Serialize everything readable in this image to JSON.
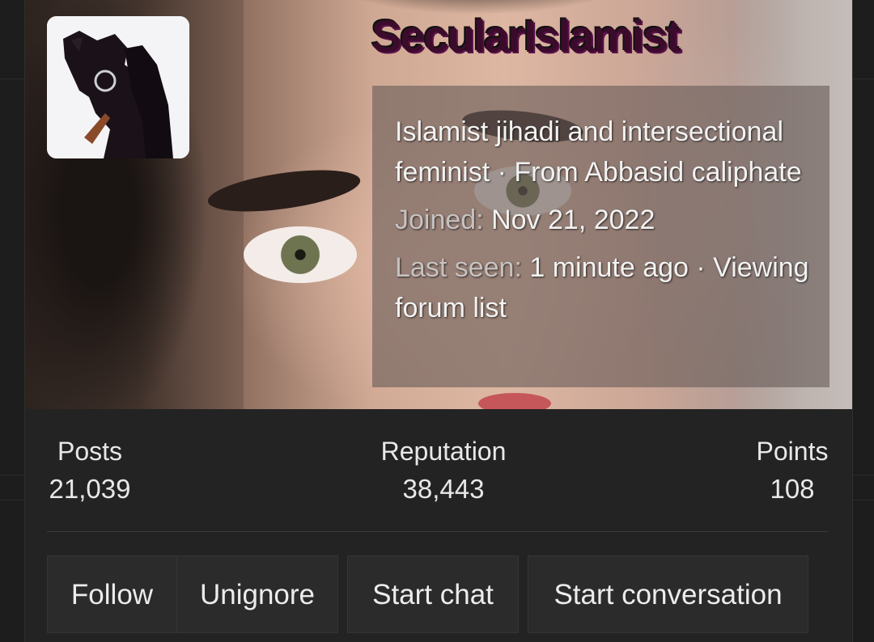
{
  "profile": {
    "username": "SecularIslamist",
    "bio": "Islamist jihadi and intersectional feminist · From Abbasid caliphate",
    "joined_label": "Joined:",
    "joined_value": "Nov 21, 2022",
    "last_seen_label": "Last seen:",
    "last_seen_value": "1 minute ago · Viewing forum list"
  },
  "stats": [
    {
      "label": "Posts",
      "value": "21,039"
    },
    {
      "label": "Reputation",
      "value": "38,443"
    },
    {
      "label": "Points",
      "value": "108"
    }
  ],
  "actions": {
    "follow": "Follow",
    "unignore": "Unignore",
    "start_chat": "Start chat",
    "start_conversation": "Start conversation"
  },
  "colors": {
    "username": "#3b0b2b",
    "card_bg": "#232323",
    "button_bg": "#2b2b2b"
  }
}
